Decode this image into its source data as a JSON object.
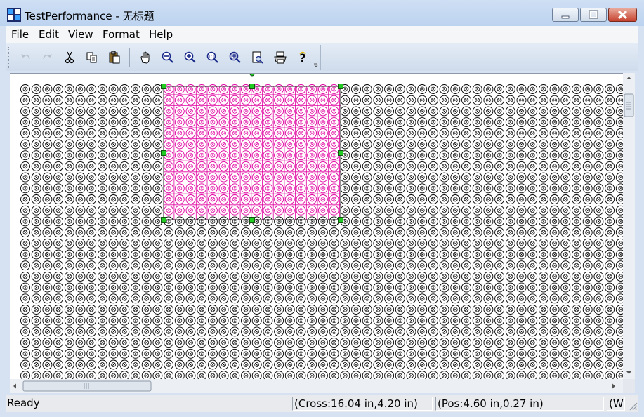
{
  "window": {
    "title": "TestPerformance - 无标题",
    "app_icon": "app-logo-icon",
    "caption_buttons": [
      "minimize-icon",
      "maximize-icon",
      "close-icon"
    ]
  },
  "menubar": {
    "items": [
      {
        "label": "File"
      },
      {
        "label": "Edit"
      },
      {
        "label": "View"
      },
      {
        "label": "Format"
      },
      {
        "label": "Help"
      }
    ]
  },
  "toolbar": {
    "buttons": [
      {
        "name": "undo-icon",
        "enabled": false
      },
      {
        "name": "redo-icon",
        "enabled": false
      },
      {
        "name": "cut-icon",
        "enabled": true
      },
      {
        "name": "copy-icon",
        "enabled": true
      },
      {
        "name": "paste-icon",
        "enabled": true
      },
      {
        "name": "pan-hand-icon",
        "enabled": true
      },
      {
        "name": "zoom-out-icon",
        "enabled": true
      },
      {
        "name": "zoom-in-icon",
        "enabled": true
      },
      {
        "name": "zoom-actual-icon",
        "enabled": true
      },
      {
        "name": "zoom-fit-icon",
        "enabled": true
      },
      {
        "name": "print-preview-icon",
        "enabled": true
      },
      {
        "name": "print-icon",
        "enabled": true
      },
      {
        "name": "help-icon",
        "enabled": true
      }
    ]
  },
  "canvas": {
    "symbol_color": "#000000",
    "selection_color": "#e000a0",
    "handle_color": "#22cc22"
  },
  "statusbar": {
    "ready": "Ready",
    "cross": "(Cross:16.04 in,4.20 in)",
    "pos": "(Pos:4.60 in,0.27 in)",
    "extra": "(W"
  }
}
